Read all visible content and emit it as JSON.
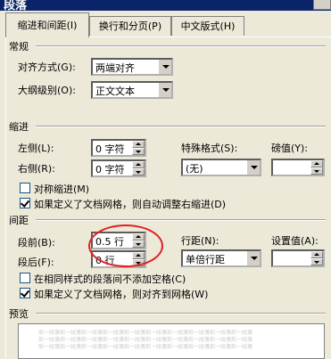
{
  "window": {
    "title": "段落"
  },
  "tabs": [
    {
      "label": "缩进和间距(I)",
      "active": true
    },
    {
      "label": "换行和分页(P)",
      "active": false
    },
    {
      "label": "中文版式(H)",
      "active": false
    }
  ],
  "general": {
    "heading": "常规",
    "alignment": {
      "label": "对齐方式(G):",
      "value": "两端对齐"
    },
    "outline": {
      "label": "大纲级别(O):",
      "value": "正文文本"
    }
  },
  "indent": {
    "heading": "缩进",
    "left": {
      "label": "左侧(L):",
      "value": "0 字符"
    },
    "right": {
      "label": "右侧(R):",
      "value": "0 字符"
    },
    "special": {
      "label": "特殊格式(S):",
      "value": "(无)"
    },
    "by": {
      "label": "磅值(Y):",
      "value": ""
    },
    "mirror": {
      "label": "对称缩进(M)",
      "checked": false
    },
    "auto_adjust": {
      "label": "如果定义了文档网格，则自动调整右缩进(D)",
      "checked": true
    }
  },
  "spacing": {
    "heading": "间距",
    "before": {
      "label": "段前(B):",
      "value": "0.5 行"
    },
    "after": {
      "label": "段后(F):",
      "value": "0 行"
    },
    "line_spacing": {
      "label": "行距(N):",
      "value": "单倍行距"
    },
    "at": {
      "label": "设置值(A):",
      "value": ""
    },
    "no_space_same_style": {
      "label": "在相同样式的段落间不添加空格(C)",
      "checked": false
    },
    "snap_to_grid": {
      "label": "如果定义了文档网格，则对齐到网格(W)",
      "checked": true
    }
  },
  "preview": {
    "heading": "预览",
    "sample_text": "前一段落前一段落前一段落前一段落前一段落前一段落前一段落前一段落前一段落前一段落"
  },
  "colors": {
    "annotation": "#e02020",
    "dialog_bg": "#ece9d8",
    "titlebar": "#0a246a"
  }
}
